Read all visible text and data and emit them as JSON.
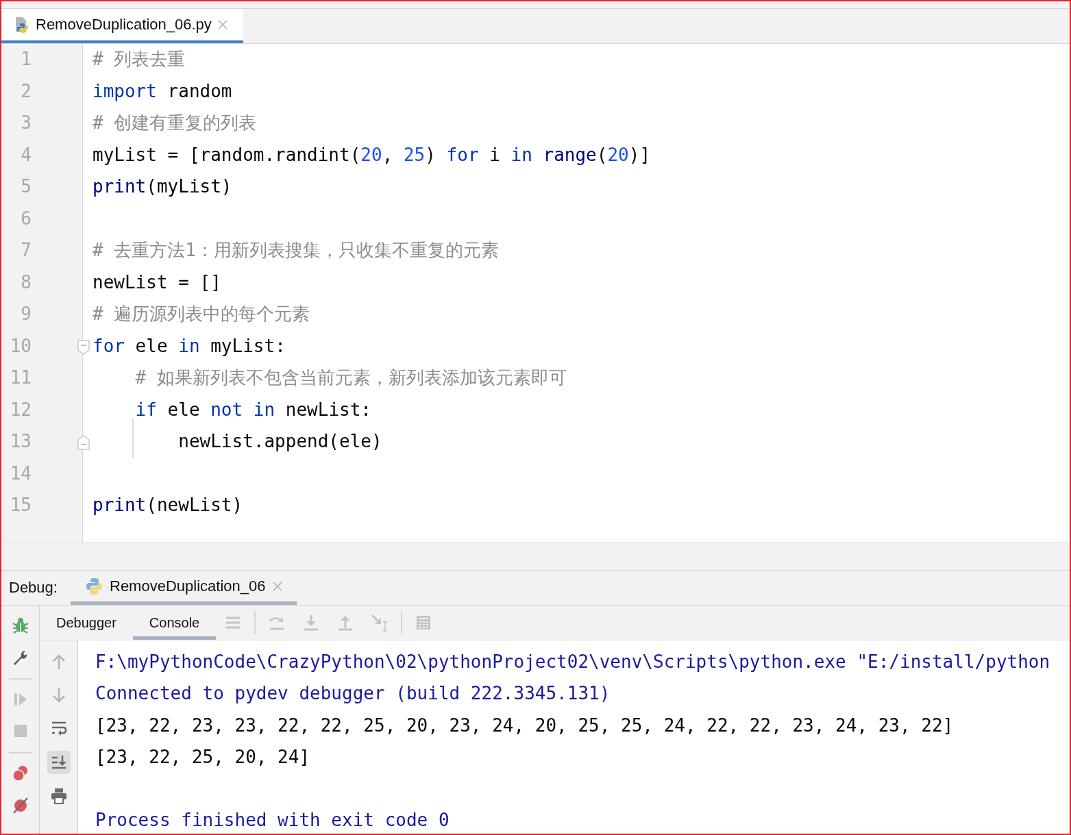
{
  "editor_tabs": [
    {
      "label": "RemoveDuplication_06.py",
      "selected": true
    }
  ],
  "editor": {
    "lines": [
      {
        "number": "1",
        "tokens": [
          {
            "kind": "comment",
            "text": "# 列表去重"
          }
        ]
      },
      {
        "number": "2",
        "tokens": [
          {
            "kind": "keyword",
            "text": "import"
          },
          {
            "kind": "plain",
            "text": " random"
          }
        ]
      },
      {
        "number": "3",
        "tokens": [
          {
            "kind": "comment",
            "text": "# 创建有重复的列表"
          }
        ]
      },
      {
        "number": "4",
        "tokens": [
          {
            "kind": "plain",
            "text": "myList = [random.randint("
          },
          {
            "kind": "number",
            "text": "20"
          },
          {
            "kind": "plain",
            "text": ", "
          },
          {
            "kind": "number",
            "text": "25"
          },
          {
            "kind": "plain",
            "text": ") "
          },
          {
            "kind": "keyword",
            "text": "for"
          },
          {
            "kind": "plain",
            "text": " i "
          },
          {
            "kind": "keyword",
            "text": "in"
          },
          {
            "kind": "builtin",
            "text": " range"
          },
          {
            "kind": "plain",
            "text": "("
          },
          {
            "kind": "number",
            "text": "20"
          },
          {
            "kind": "plain",
            "text": ")]"
          }
        ]
      },
      {
        "number": "5",
        "tokens": [
          {
            "kind": "builtin",
            "text": "print"
          },
          {
            "kind": "plain",
            "text": "(myList)"
          }
        ]
      },
      {
        "number": "6"
      },
      {
        "number": "7",
        "tokens": [
          {
            "kind": "comment",
            "text": "# 去重方法1：用新列表搜集，只收集不重复的元素"
          }
        ]
      },
      {
        "number": "8",
        "tokens": [
          {
            "kind": "plain",
            "text": "newList = []"
          }
        ]
      },
      {
        "number": "9",
        "tokens": [
          {
            "kind": "comment",
            "text": "# 遍历源列表中的每个元素"
          }
        ]
      },
      {
        "number": "10",
        "fold_start": true,
        "tokens": [
          {
            "kind": "keyword",
            "text": "for"
          },
          {
            "kind": "plain",
            "text": " ele "
          },
          {
            "kind": "keyword",
            "text": "in"
          },
          {
            "kind": "plain",
            "text": " myList:"
          }
        ]
      },
      {
        "number": "11",
        "tokens": [
          {
            "kind": "comment",
            "text": "    # 如果新列表不包含当前元素，新列表添加该元素即可"
          }
        ]
      },
      {
        "number": "12",
        "tokens": [
          {
            "kind": "keyword",
            "text": "    if"
          },
          {
            "kind": "plain",
            "text": " ele "
          },
          {
            "kind": "keyword",
            "text": "not in"
          },
          {
            "kind": "plain",
            "text": " newList:"
          }
        ]
      },
      {
        "number": "13",
        "fold_end": true,
        "indent_guide": true,
        "tokens": [
          {
            "kind": "plain",
            "text": "        newList.append(ele)"
          }
        ]
      },
      {
        "number": "14"
      },
      {
        "number": "15",
        "tokens": [
          {
            "kind": "builtin",
            "text": "print"
          },
          {
            "kind": "plain",
            "text": "(newList)"
          }
        ]
      }
    ]
  },
  "debug": {
    "title": "Debug:",
    "session_tab": {
      "label": "RemoveDuplication_06",
      "selected": true
    },
    "tabs": [
      {
        "label": "Debugger",
        "selected": false
      },
      {
        "label": "Console",
        "selected": true
      }
    ],
    "toolbar": [
      {
        "kind": "threads",
        "disabled": true
      },
      {
        "kind": "separator"
      },
      {
        "kind": "step-over",
        "disabled": true
      },
      {
        "kind": "step-into",
        "disabled": true
      },
      {
        "kind": "step-out",
        "disabled": true
      },
      {
        "kind": "run-to-cursor",
        "disabled": true
      },
      {
        "kind": "separator"
      },
      {
        "kind": "evaluate",
        "disabled": true
      }
    ],
    "side_tools": [
      {
        "kind": "bug",
        "disabled": false
      },
      {
        "kind": "wrench",
        "disabled": false
      },
      {
        "kind": "separator"
      },
      {
        "kind": "resume",
        "disabled": true
      },
      {
        "kind": "stop",
        "disabled": true
      },
      {
        "kind": "separator"
      },
      {
        "kind": "breakpoints",
        "disabled": false
      },
      {
        "kind": "mute",
        "disabled": false
      }
    ],
    "console_tools": [
      {
        "kind": "up",
        "selected": false
      },
      {
        "kind": "down",
        "selected": false
      },
      {
        "kind": "wrap",
        "selected": false
      },
      {
        "kind": "scroll-end",
        "selected": true
      },
      {
        "kind": "print",
        "selected": false
      }
    ],
    "console": [
      {
        "kind": "system",
        "text": "F:\\myPythonCode\\CrazyPython\\02\\pythonProject02\\venv\\Scripts\\python.exe \"E:/install/python"
      },
      {
        "kind": "system",
        "text": "Connected to pydev debugger (build 222.3345.131)"
      },
      {
        "kind": "output",
        "text": "[23, 22, 23, 23, 22, 22, 25, 20, 23, 24, 20, 25, 25, 24, 22, 22, 23, 24, 23, 22]"
      },
      {
        "kind": "output",
        "text": "[23, 22, 25, 20, 24]"
      },
      {
        "kind": "exit",
        "text": "Process finished with exit code 0"
      }
    ]
  }
}
